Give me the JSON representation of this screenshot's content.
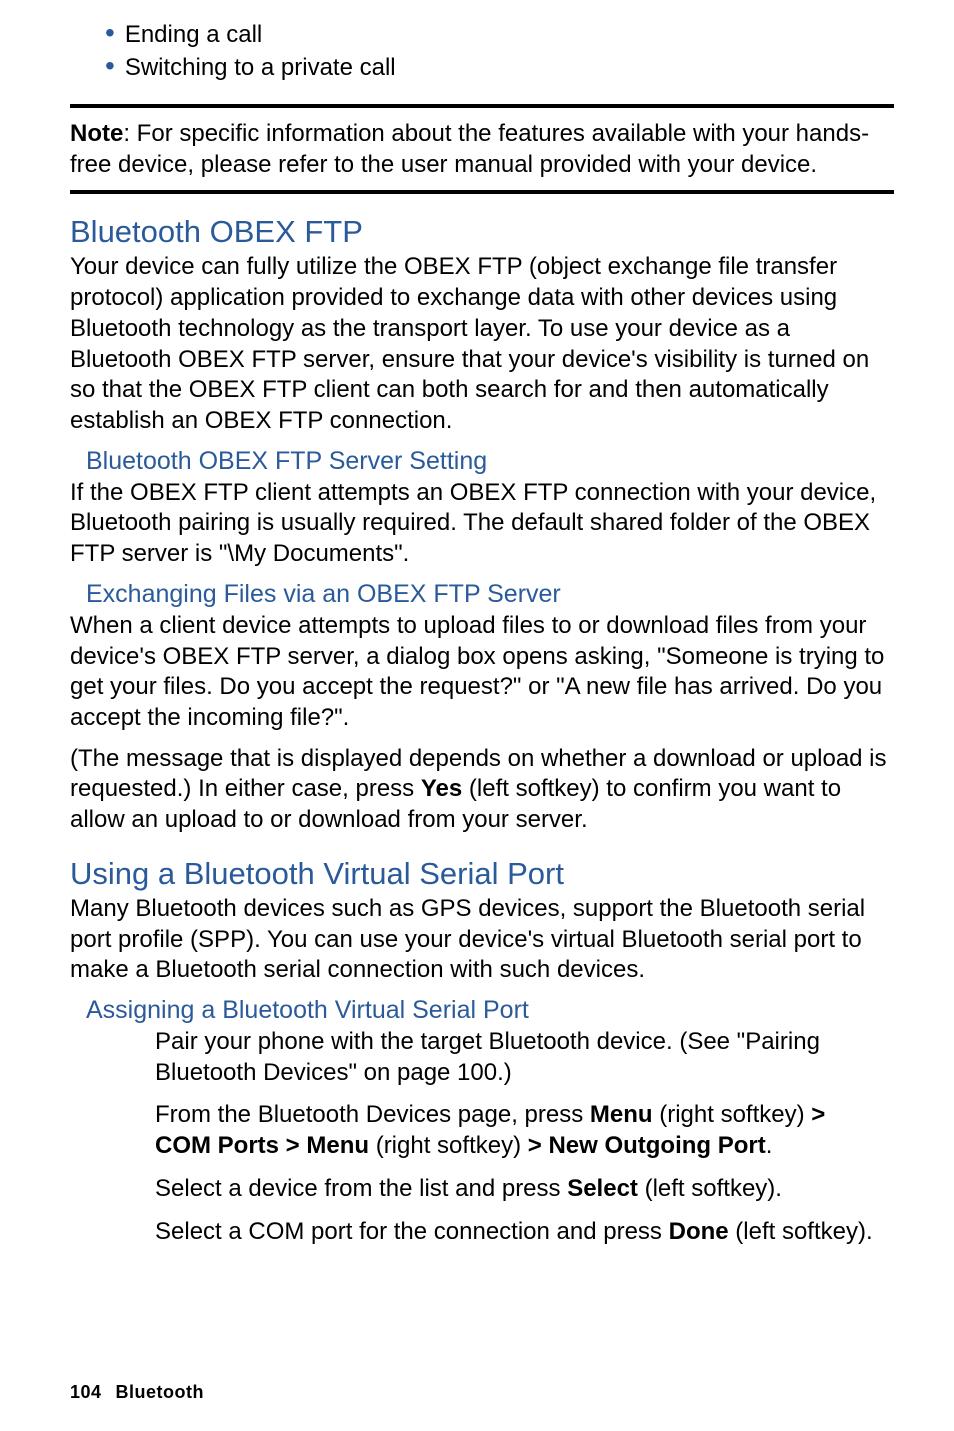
{
  "bullets": {
    "item1": "Ending a call",
    "item2": "Switching to a private call"
  },
  "note": {
    "label": "Note",
    "text": ": For specific information about the features available with your hands-free device, please refer to the user manual provided with your device."
  },
  "section1": {
    "heading": "Bluetooth OBEX FTP",
    "p1": "Your device can fully utilize the OBEX FTP (object exchange file transfer protocol) application provided to exchange data with other devices using Bluetooth technology as the transport layer. To use your device as a Bluetooth OBEX FTP server, ensure that your device's visibility is turned on so that the OBEX FTP client can both search for and then automatically establish an OBEX FTP connection.",
    "sub1_heading": "Bluetooth OBEX FTP Server Setting",
    "sub1_p": "If the OBEX FTP client attempts an OBEX FTP connection with your device, Bluetooth pairing is usually required. The default shared folder of the OBEX FTP server is \"\\My Documents\".",
    "sub2_heading": "Exchanging Files via an OBEX FTP Server",
    "sub2_p1": "When a client device attempts to upload files to or download files from your device's OBEX FTP server, a dialog box opens asking, \"Someone is trying to get your files. Do you accept the request?\" or \"A new file has arrived. Do you accept the incoming file?\".",
    "sub2_p2_a": "(The message that is displayed depends on whether a download or upload is requested.) In either case, press ",
    "sub2_p2_yes": "Yes",
    "sub2_p2_b": " (left softkey) to confirm you want to allow an upload to or download from your server."
  },
  "section2": {
    "heading": "Using a Bluetooth Virtual Serial Port",
    "p1": "Many Bluetooth devices such as GPS devices, support the Bluetooth serial port profile (SPP). You can use your device's virtual Bluetooth serial port to make a Bluetooth serial connection with such devices.",
    "sub1_heading": "Assigning a Bluetooth Virtual Serial Port",
    "step1": "Pair your phone with the target Bluetooth device. (See \"Pairing Bluetooth Devices\" on page 100.)",
    "step2_a": "From the Bluetooth Devices page, press ",
    "step2_menu1": "Menu",
    "step2_b": " (right softkey) ",
    "step2_gt1": "> ",
    "step2_com": "COM Ports > Menu",
    "step2_c": " (right softkey) ",
    "step2_gt2": "> ",
    "step2_newport": "New Outgoing Port",
    "step2_d": ".",
    "step3_a": "Select a device from the list and press ",
    "step3_select": "Select",
    "step3_b": " (left softkey).",
    "step4_a": "Select a COM port for the connection and press ",
    "step4_done": "Done",
    "step4_b": " (left softkey)."
  },
  "footer": {
    "page": "104",
    "chapter": "Bluetooth"
  }
}
